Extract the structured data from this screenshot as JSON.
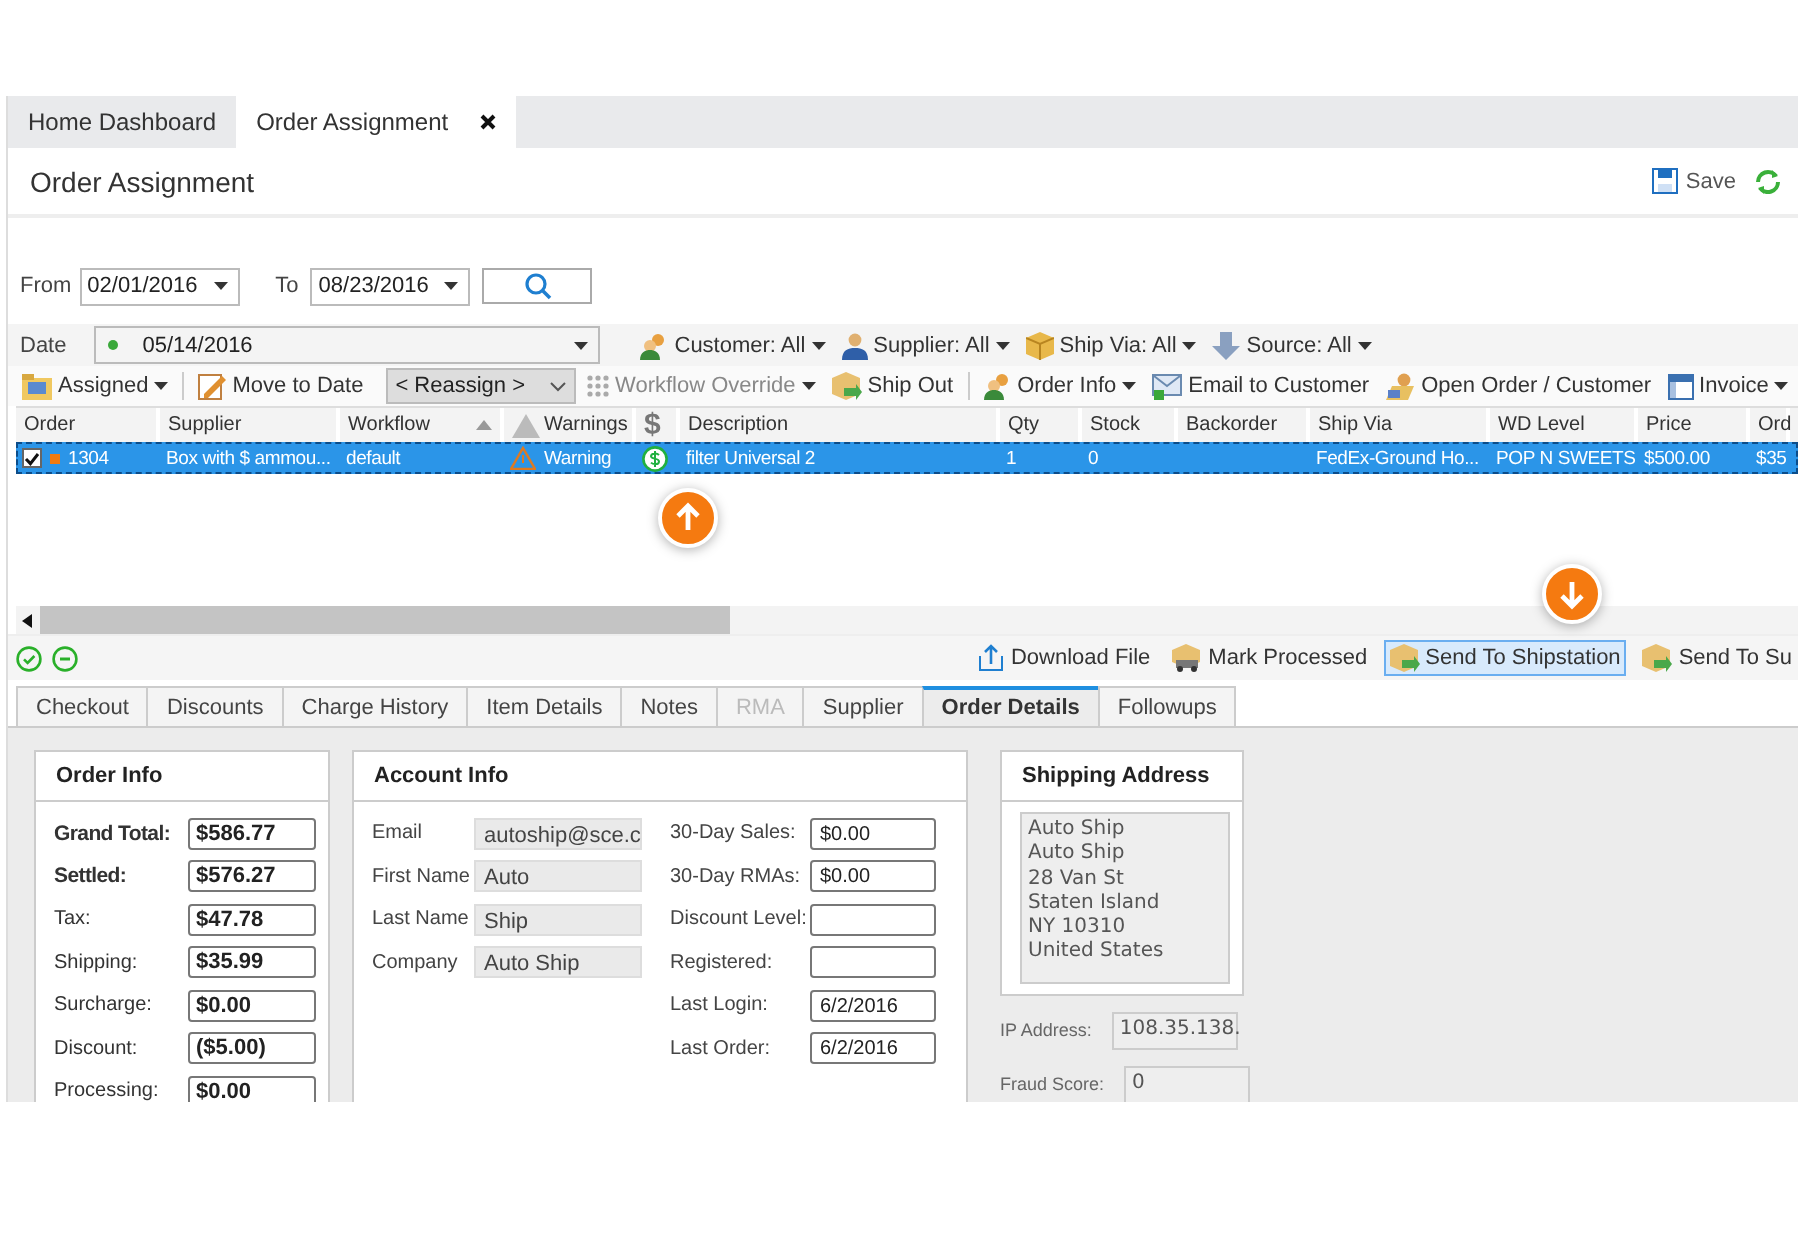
{
  "tabs": [
    {
      "label": "Home Dashboard",
      "selected": false,
      "closable": false
    },
    {
      "label": "Order Assignment",
      "selected": true,
      "closable": true
    }
  ],
  "page": {
    "title": "Order Assignment",
    "save_label": "Save"
  },
  "range": {
    "from_label": "From",
    "from_value": "02/01/2016",
    "to_label": "To",
    "to_value": "08/23/2016"
  },
  "date_filter": {
    "label": "Date",
    "value": "05/14/2016"
  },
  "filters": [
    {
      "label": "Customer: All"
    },
    {
      "label": "Supplier: All"
    },
    {
      "label": "Ship Via: All"
    },
    {
      "label": "Source: All"
    }
  ],
  "toolbar": [
    {
      "label": "Assigned",
      "kind": "dropdown",
      "disabled": false
    },
    {
      "label": "Move to Date",
      "kind": "button",
      "disabled": false
    },
    {
      "label": "< Reassign >",
      "kind": "select",
      "disabled": false
    },
    {
      "label": "Workflow Override",
      "kind": "dropdown",
      "disabled": true
    },
    {
      "label": "Ship Out",
      "kind": "button",
      "disabled": false
    },
    {
      "label": "Order Info",
      "kind": "dropdown",
      "disabled": false
    },
    {
      "label": "Email to Customer",
      "kind": "button",
      "disabled": false
    },
    {
      "label": "Open Order / Customer",
      "kind": "button",
      "disabled": false
    },
    {
      "label": "Invoice",
      "kind": "dropdown",
      "disabled": false
    }
  ],
  "grid": {
    "columns": [
      {
        "label": "Order",
        "sorted": false
      },
      {
        "label": "Supplier",
        "sorted": false
      },
      {
        "label": "Workflow",
        "sorted": true
      },
      {
        "label": "Warnings",
        "sorted": false
      },
      {
        "label": "$",
        "sorted": false
      },
      {
        "label": "Description",
        "sorted": false
      },
      {
        "label": "Qty",
        "sorted": false
      },
      {
        "label": "Stock",
        "sorted": false
      },
      {
        "label": "Backorder",
        "sorted": false
      },
      {
        "label": "Ship Via",
        "sorted": false
      },
      {
        "label": "WD Level",
        "sorted": false
      },
      {
        "label": "Price",
        "sorted": false
      },
      {
        "label": "Ord",
        "sorted": false
      }
    ],
    "rows": [
      {
        "checked": true,
        "selected": true,
        "order": "1304",
        "supplier": "Box with $ ammou...",
        "workflow": "default",
        "warning": "Warning",
        "description": "filter Universal 2",
        "qty": "1",
        "stock": "0",
        "ship_via": "FedEx-Ground Ho...",
        "wd_level": "POP N SWEETS",
        "price": "$500.00",
        "ord": "$35"
      }
    ]
  },
  "actions": [
    {
      "label": "Download File",
      "selected": false
    },
    {
      "label": "Mark Processed",
      "selected": false
    },
    {
      "label": "Send To Shipstation",
      "selected": true
    },
    {
      "label": "Send To Su",
      "selected": false
    }
  ],
  "detail_tabs": [
    {
      "label": "Checkout",
      "selected": false,
      "disabled": false
    },
    {
      "label": "Discounts",
      "selected": false,
      "disabled": false
    },
    {
      "label": "Charge History",
      "selected": false,
      "disabled": false
    },
    {
      "label": "Item Details",
      "selected": false,
      "disabled": false
    },
    {
      "label": "Notes",
      "selected": false,
      "disabled": false
    },
    {
      "label": "RMA",
      "selected": false,
      "disabled": true
    },
    {
      "label": "Supplier",
      "selected": false,
      "disabled": false
    },
    {
      "label": "Order Details",
      "selected": true,
      "disabled": false
    },
    {
      "label": "Followups",
      "selected": false,
      "disabled": false
    }
  ],
  "order_info": {
    "title": "Order Info",
    "rows": [
      {
        "label": "Grand Total:",
        "value": "$586.77",
        "bold": true
      },
      {
        "label": "Settled:",
        "value": "$576.27",
        "bold": true
      },
      {
        "label": "Tax:",
        "value": "$47.78",
        "bold": false
      },
      {
        "label": "Shipping:",
        "value": "$35.99",
        "bold": false
      },
      {
        "label": "Surcharge:",
        "value": "$0.00",
        "bold": false
      },
      {
        "label": "Discount:",
        "value": "($5.00)",
        "bold": false
      },
      {
        "label": "Processing:",
        "value": "$0.00",
        "bold": false
      }
    ]
  },
  "account_info": {
    "title": "Account Info",
    "left": [
      {
        "label": "Email",
        "value": "autoship@sce.c",
        "readonly": true
      },
      {
        "label": "First Name",
        "value": "Auto",
        "readonly": true
      },
      {
        "label": "Last Name",
        "value": "Ship",
        "readonly": true
      },
      {
        "label": "Company",
        "value": "Auto Ship",
        "readonly": true
      }
    ],
    "right": [
      {
        "label": "30-Day Sales:",
        "value": "$0.00",
        "readonly": false
      },
      {
        "label": "30-Day RMAs:",
        "value": "$0.00",
        "readonly": false
      },
      {
        "label": "Discount Level:",
        "readonly": false
      },
      {
        "label": "Registered:",
        "readonly": false
      },
      {
        "label": "Last Login:",
        "value": "6/2/2016",
        "readonly": false
      },
      {
        "label": "Last Order:",
        "value": "6/2/2016",
        "readonly": false
      }
    ]
  },
  "shipping_address": {
    "title": "Shipping Address",
    "lines": [
      "Auto Ship",
      "Auto Ship",
      "28 Van St",
      "Staten Island",
      "NY 10310",
      "United States"
    ]
  },
  "extra_fields": [
    {
      "label": "IP Address:",
      "value": "108.35.138."
    },
    {
      "label": "Fraud Score:",
      "value": "0"
    }
  ]
}
